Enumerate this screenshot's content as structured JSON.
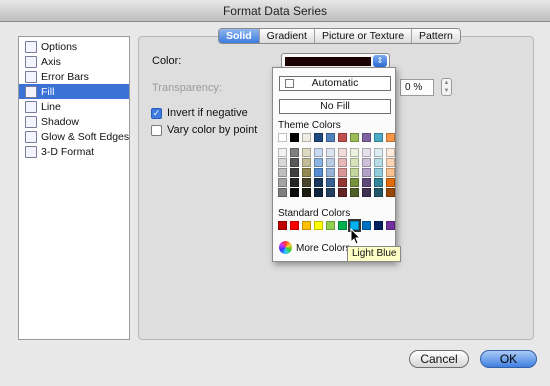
{
  "window": {
    "title": "Format Data Series"
  },
  "sidebar": {
    "items": [
      {
        "label": "Options",
        "icon": "options-icon"
      },
      {
        "label": "Axis",
        "icon": "axis-icon"
      },
      {
        "label": "Error Bars",
        "icon": "error-bars-icon"
      },
      {
        "label": "Fill",
        "icon": "fill-bucket-icon",
        "selected": true
      },
      {
        "label": "Line",
        "icon": "line-icon"
      },
      {
        "label": "Shadow",
        "icon": "shadow-icon"
      },
      {
        "label": "Glow & Soft Edges",
        "icon": "glow-icon"
      },
      {
        "label": "3-D Format",
        "icon": "3d-format-icon"
      }
    ]
  },
  "tabs": [
    "Solid",
    "Gradient",
    "Picture or Texture",
    "Pattern"
  ],
  "fill": {
    "color_label": "Color:",
    "color_value": "#1a0000",
    "transparency_label": "Transparency:",
    "transparency_value": "0 %",
    "invert_label": "Invert if negative",
    "invert_checked": true,
    "vary_label": "Vary color by point",
    "vary_checked": false
  },
  "color_menu": {
    "automatic": "Automatic",
    "no_fill": "No Fill",
    "theme_heading": "Theme Colors",
    "theme_top": [
      "#ffffff",
      "#000000",
      "#eeece1",
      "#1f497d",
      "#4f81bd",
      "#c0504d",
      "#9bbb59",
      "#8064a2",
      "#4bacc6",
      "#f79646"
    ],
    "theme_columns": [
      [
        "#f2f2f2",
        "#d8d8d8",
        "#bfbfbf",
        "#a5a5a5",
        "#7f7f7f"
      ],
      [
        "#7f7f7f",
        "#595959",
        "#3f3f3f",
        "#262626",
        "#0c0c0c"
      ],
      [
        "#ddd9c3",
        "#c4bd97",
        "#938953",
        "#494429",
        "#1d1b10"
      ],
      [
        "#c6d9f0",
        "#8db3e2",
        "#548dd4",
        "#17365d",
        "#0f243e"
      ],
      [
        "#dbe5f1",
        "#b8cce4",
        "#95b3d7",
        "#366092",
        "#244061"
      ],
      [
        "#f2dcdb",
        "#e5b9b7",
        "#d99694",
        "#953734",
        "#632423"
      ],
      [
        "#ebf1dd",
        "#d7e3bc",
        "#c3d69b",
        "#76923c",
        "#4f6128"
      ],
      [
        "#e5e0ec",
        "#ccc1d9",
        "#b2a2c7",
        "#5f497a",
        "#3f3151"
      ],
      [
        "#dbeef3",
        "#b7dde8",
        "#92cddc",
        "#31859b",
        "#205867"
      ],
      [
        "#fdeada",
        "#fbd5b5",
        "#fac08f",
        "#e36c09",
        "#974806"
      ]
    ],
    "standard_heading": "Standard Colors",
    "standard": [
      "#c00000",
      "#ff0000",
      "#ffc000",
      "#ffff00",
      "#92d050",
      "#00b050",
      "#00b0f0",
      "#0070c0",
      "#002060",
      "#7030a0"
    ],
    "more": "More Colors...",
    "tooltip": "Light Blue"
  },
  "buttons": {
    "cancel": "Cancel",
    "ok": "OK"
  }
}
